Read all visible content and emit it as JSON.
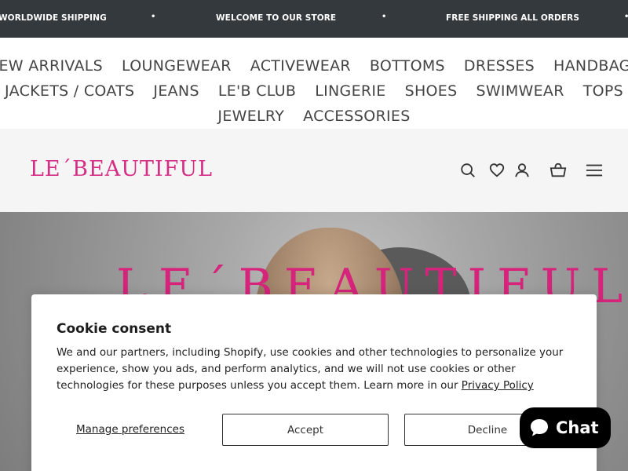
{
  "announcement": {
    "messages": [
      "WORLDWIDE SHIPPING",
      "WELCOME TO OUR STORE",
      "FREE SHIPPING ALL ORDERS"
    ],
    "separator": "•"
  },
  "nav": {
    "row1": [
      "NEW ARRIVALS",
      "LOUNGEWEAR",
      "ACTIVEWEAR",
      "BOTTOMS",
      "DRESSES",
      "HANDBAGS"
    ],
    "row2": [
      "JACKETS / COATS",
      "JEANS",
      "LE'B CLUB",
      "LINGERIE",
      "SHOES",
      "SWIMWEAR",
      "TOPS"
    ],
    "row3": [
      "JEWELRY",
      "ACCESSORIES"
    ]
  },
  "header": {
    "logo": "LE´BEAUTIFUL",
    "icons": [
      "search-icon",
      "wishlist-heart-icon",
      "account-icon",
      "cart-basket-icon",
      "menu-hamburger-icon"
    ]
  },
  "hero": {
    "title": "LE´BEAUTIFUL"
  },
  "cookie": {
    "title": "Cookie consent",
    "body": "We and our partners, including Shopify, use cookies and other technologies to personalize your experience, show you ads, and perform analytics, and we will not use cookies or other technologies for these purposes unless you accept them. Learn more in our ",
    "privacy_link": "Privacy Policy",
    "manage": "Manage preferences",
    "accept": "Accept",
    "decline": "Decline"
  },
  "chat": {
    "label": "Chat",
    "icon": "chat-bubble-icon"
  },
  "colors": {
    "announce_bg": "#34393d",
    "brand_pink": "#d42e85",
    "header_bg": "#f5f5f5"
  }
}
